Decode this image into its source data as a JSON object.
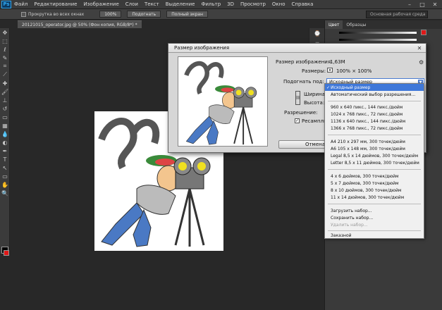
{
  "app": {
    "logo_text": "Ps"
  },
  "menu": [
    "Файл",
    "Редактирование",
    "Изображение",
    "Слои",
    "Текст",
    "Выделение",
    "Фильтр",
    "3D",
    "Просмотр",
    "Окно",
    "Справка"
  ],
  "options_bar": {
    "scroll_all_windows_label": "Прокрутка во всех окнах",
    "zoom_100_label": "100%",
    "fit_label": "Подогнать",
    "fill_screen_label": "Полный экран",
    "workspace_label": "Основная рабочая среда"
  },
  "document_tab": {
    "label": "20121015_operator.jpg @ 50% (Фон копия, RGB/8*) *"
  },
  "panels": {
    "tab_color": "Цвет",
    "tab_swatches": "Образцы"
  },
  "dialog": {
    "title": "Размер изображения",
    "image_size_label": "Размер изображения:",
    "image_size_value": "1,63M",
    "dimensions_label": "Размеры:",
    "dimensions_value": "100%  ×  100%",
    "fit_to_label": "Подогнать под:",
    "fit_to_value": "Исходный размер",
    "width_label": "Ширина:",
    "height_label": "Высота:",
    "resolution_label": "Разрешение:",
    "resample_label": "Ресамплинг:",
    "cancel_label": "Отмена"
  },
  "dropdown": {
    "items": [
      {
        "label": "Исходный размер",
        "selected": true
      },
      {
        "label": "Автоматический выбор разрешения..."
      },
      {
        "label": "960 x 640 пикс., 144 пикс./дюйм"
      },
      {
        "label": "1024 x 768 пикс., 72 пикс./дюйм"
      },
      {
        "label": "1136 x 640 пикс., 144 пикс./дюйм"
      },
      {
        "label": "1366 x 768 пикс., 72 пикс./дюйм"
      },
      {
        "label": "A4 210 x 297 мм, 300 точек/дюйм"
      },
      {
        "label": "A6 105 x 148 мм, 300 точек/дюйм"
      },
      {
        "label": "Legal 8,5 x 14 дюймов, 300 точек/дюйм"
      },
      {
        "label": "Letter 8,5 x 11 дюймов, 300 точек/дюйм"
      },
      {
        "label": "4 x 6 дюймов, 300 точек/дюйм"
      },
      {
        "label": "5 x 7 дюймов, 300 точек/дюйм"
      },
      {
        "label": "8 x 10 дюймов, 300 точек/дюйм"
      },
      {
        "label": "11 x 14 дюймов, 300 точек/дюйм"
      },
      {
        "label": "Загрузить набор..."
      },
      {
        "label": "Сохранить набор..."
      },
      {
        "label": "Удалить набор...",
        "disabled": true
      },
      {
        "label": "Заказной"
      }
    ]
  },
  "colors": {
    "accent": "#3f78d9",
    "foreground": "#000000",
    "background_swatch": "#e01818"
  }
}
